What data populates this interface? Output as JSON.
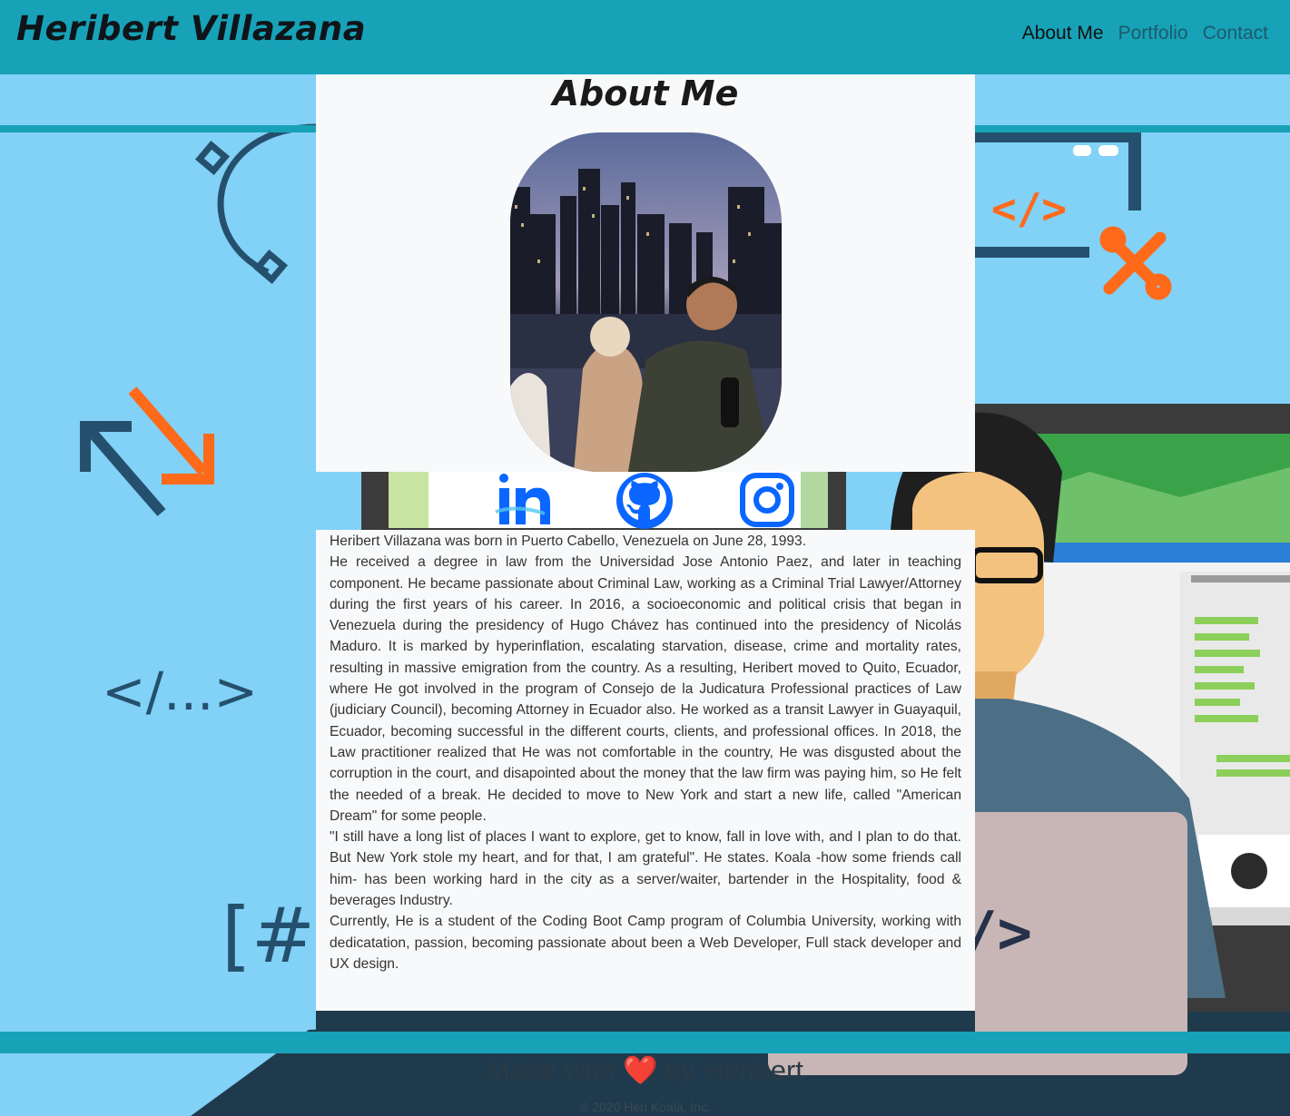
{
  "navbar": {
    "brand": "Heribert Villazana",
    "links": [
      {
        "label": "About Me"
      },
      {
        "label": "Portfolio"
      },
      {
        "label": "Contact"
      }
    ]
  },
  "about": {
    "title": "About Me",
    "photo_icon": "profile-photo"
  },
  "socials": [
    {
      "icon": "linkedin-icon"
    },
    {
      "icon": "github-icon"
    },
    {
      "icon": "instagram-icon"
    }
  ],
  "bio": {
    "paragraphs": [
      "Heribert Villazana was born in Puerto Cabello, Venezuela on June 28, 1993.",
      "He received a degree in law from the Universidad Jose Antonio Paez, and later in teaching component. He became passionate about Criminal Law, working as a Criminal Trial Lawyer/Attorney during the first years of his career. In 2016, a socioeconomic and political crisis that began in Venezuela during the presidency of Hugo Chávez has continued into the presidency of Nicolás Maduro. It is marked by hyperinflation, escalating starvation, disease, crime and mortality rates, resulting in massive emigration from the country. As a resulting, Heribert moved to Quito, Ecuador, where He got involved in the program of Consejo de la Judicatura Professional practices of Law (judiciary Council), becoming Attorney in Ecuador also. He worked as a transit Lawyer in Guayaquil, Ecuador, becoming successful in the different courts, clients, and professional offices. In 2018, the Law practitioner realized that He was not comfortable in the country, He was disgusted about the corruption in the court, and disapointed about the money that the law firm was paying him, so He felt the needed of a break. He decided to move to New York and start a new life, called \"American Dream\" for some people.",
      "\"I still have a long list of places I want to explore, get to know, fall in love with, and I plan to do that. But New York stole my heart, and for that, I am grateful\". He states. Koala -how some friends call him- has been working hard in the city as a server/waiter, bartender in the Hospitality, food & beverages Industry.",
      "Currently, He is a student of the Coding Boot Camp program of Columbia University, working with dedicatation, passion, becoming passionate about been a Web Developer, Full stack developer and UX design."
    ]
  },
  "background": {
    "code_text_left": "</...>",
    "code_tag": "</>",
    "hash_text": "[#]",
    "laptop_text": "/>"
  },
  "footer": {
    "made_prefix": "Made with",
    "heart": "❤️",
    "made_suffix": "by Heribert",
    "copyright": "© 2020 Heri Koala, Inc."
  },
  "colors": {
    "navbar": "#17a2b8",
    "background": "#82d1f6",
    "card": "#f8f9fa",
    "accent_orange": "#ff6a1a",
    "dark_navy": "#25506d"
  }
}
